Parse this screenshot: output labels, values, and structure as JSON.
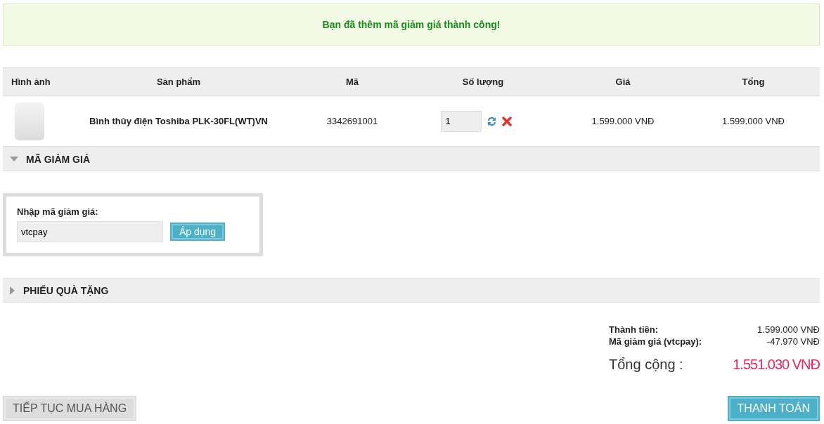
{
  "alert": {
    "message": "Bạn đã thêm mã giảm giá thành công!"
  },
  "table": {
    "columns": [
      "Hình ảnh",
      "Sản phẩm",
      "Mã",
      "Số lượng",
      "Giá",
      "Tổng"
    ],
    "rows": [
      {
        "product": "Bình thủy điện Toshiba PLK-30FL(WT)VN",
        "code": "3342691001",
        "quantity": "1",
        "price": "1.599.000 VNĐ",
        "total": "1.599.000 VNĐ"
      }
    ]
  },
  "sections": [
    {
      "title": "MÃ GIẢM GIÁ",
      "expanded": true,
      "label": "Nhập mã giảm giá:",
      "value": "vtcpay",
      "button": "Áp dụng"
    },
    {
      "title": "PHIẾU QUÀ TẶNG",
      "expanded": false
    }
  ],
  "summary": {
    "lines": [
      {
        "label": "Thành tiền:",
        "value": "1.599.000 VNĐ"
      },
      {
        "label": "Mã giảm giá (vtcpay):",
        "value": "-47.970 VNĐ"
      }
    ],
    "total_label": "Tổng cộng :",
    "total_value": "1.551.030 VNĐ"
  },
  "buttons": {
    "continue": "TIẾP TỤC MUA HÀNG",
    "checkout": "THANH TOÁN"
  }
}
